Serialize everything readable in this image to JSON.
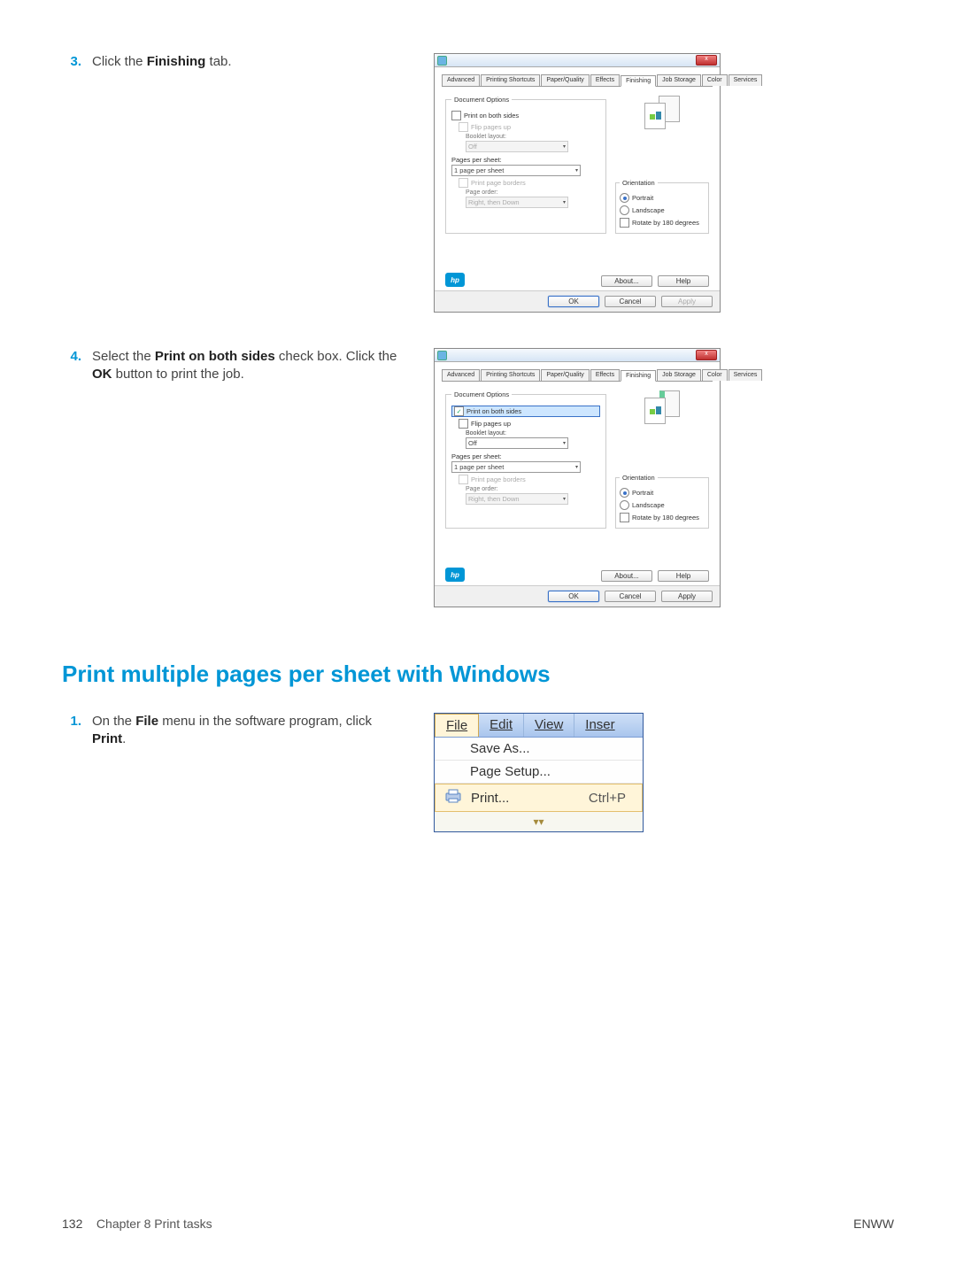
{
  "steps": {
    "s3": {
      "num": "3.",
      "text_before": "Click the ",
      "bold": "Finishing",
      "text_after": " tab."
    },
    "s4": {
      "num": "4.",
      "line1_a": "Select the ",
      "line1_b": "Print on both sides",
      "line1_c": " check box. Click the ",
      "line1_d": "OK",
      "line1_e": " button to print the job."
    },
    "s1": {
      "num": "1.",
      "a": "On the ",
      "b": "File",
      "c": " menu in the software program, click ",
      "d": "Print",
      "e": "."
    }
  },
  "section_heading": "Print multiple pages per sheet with Windows",
  "dialog": {
    "tabs": [
      "Advanced",
      "Printing Shortcuts",
      "Paper/Quality",
      "Effects",
      "Finishing",
      "Job Storage",
      "Color",
      "Services"
    ],
    "active_tab": "Finishing",
    "group_doc_options": "Document Options",
    "chk_print_both": "Print on both sides",
    "chk_flip": "Flip pages up",
    "lbl_booklet": "Booklet layout:",
    "ddl_booklet": "Off",
    "lbl_ppsheet": "Pages per sheet:",
    "ddl_ppsheet": "1 page per sheet",
    "chk_borders": "Print page borders",
    "lbl_pageorder": "Page order:",
    "ddl_pageorder": "Right, then Down",
    "group_orientation": "Orientation",
    "radio_portrait": "Portrait",
    "radio_landscape": "Landscape",
    "chk_rotate": "Rotate by 180 degrees",
    "btn_about": "About...",
    "btn_help": "Help",
    "btn_ok": "OK",
    "btn_cancel": "Cancel",
    "btn_apply": "Apply",
    "hp_logo_text": "hp",
    "close_x": "x"
  },
  "menu": {
    "bar": {
      "file": "File",
      "edit": "Edit",
      "view": "View",
      "insert": "Inser"
    },
    "items": {
      "saveas": "Save As...",
      "pagesetup": "Page Setup...",
      "print": "Print...",
      "print_shortcut": "Ctrl+P"
    },
    "expand_icon": "▾"
  },
  "footer": {
    "page_num": "132",
    "chapter": "Chapter 8   Print tasks",
    "brand": "ENWW"
  }
}
